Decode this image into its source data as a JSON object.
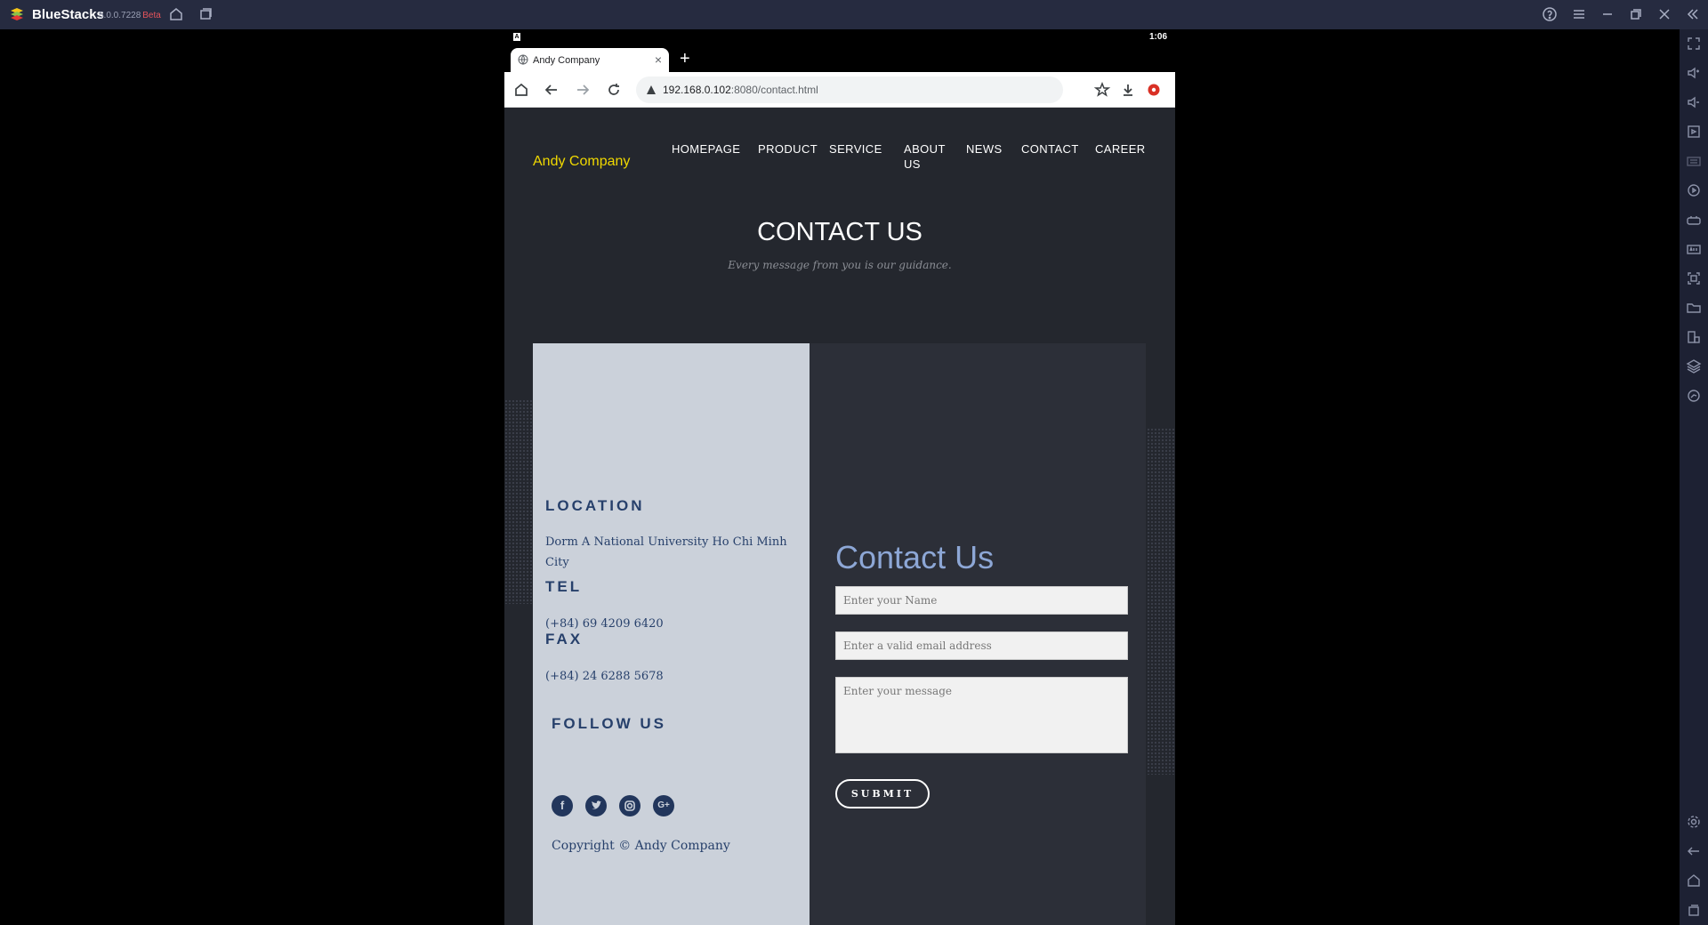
{
  "emulator": {
    "app_name": "BlueStacks",
    "version": "5.0.0.7228",
    "beta_label": "Beta"
  },
  "android": {
    "time": "1:06"
  },
  "browser": {
    "tab_title": "Andy Company",
    "new_tab": "+",
    "url_host": "192.168.0.102",
    "url_path": ":8080/contact.html"
  },
  "site": {
    "brand": "Andy Company",
    "nav": [
      "HOMEPAGE",
      "PRODUCT",
      "SERVICE",
      "ABOUT US",
      "NEWS",
      "CONTACT",
      "CAREER"
    ],
    "hero_title": "CONTACT US",
    "hero_subtitle": "Every message from you is our guidance.",
    "info": {
      "location_head": "LOCATION",
      "location_val": "Dorm A National University Ho Chi Minh City",
      "tel_head": "TEL",
      "tel_val": "(+84) 69 4209 6420",
      "fax_head": "FAX",
      "fax_val": "(+84) 24 6288 5678",
      "follow_head": "FOLLOW US",
      "copyright": "Copyright © Andy Company"
    },
    "social": [
      "facebook-icon",
      "twitter-icon",
      "instagram-icon",
      "google-plus-icon"
    ],
    "form": {
      "title": "Contact Us",
      "name_placeholder": "Enter your Name",
      "email_placeholder": "Enter a valid email address",
      "message_placeholder": "Enter your message",
      "submit": "SUBMIT"
    }
  },
  "colors": {
    "brand": "#f0d800",
    "panel_left": "#cbd1da",
    "accent_blue": "#8da7d6",
    "text_navy": "#27406b"
  }
}
